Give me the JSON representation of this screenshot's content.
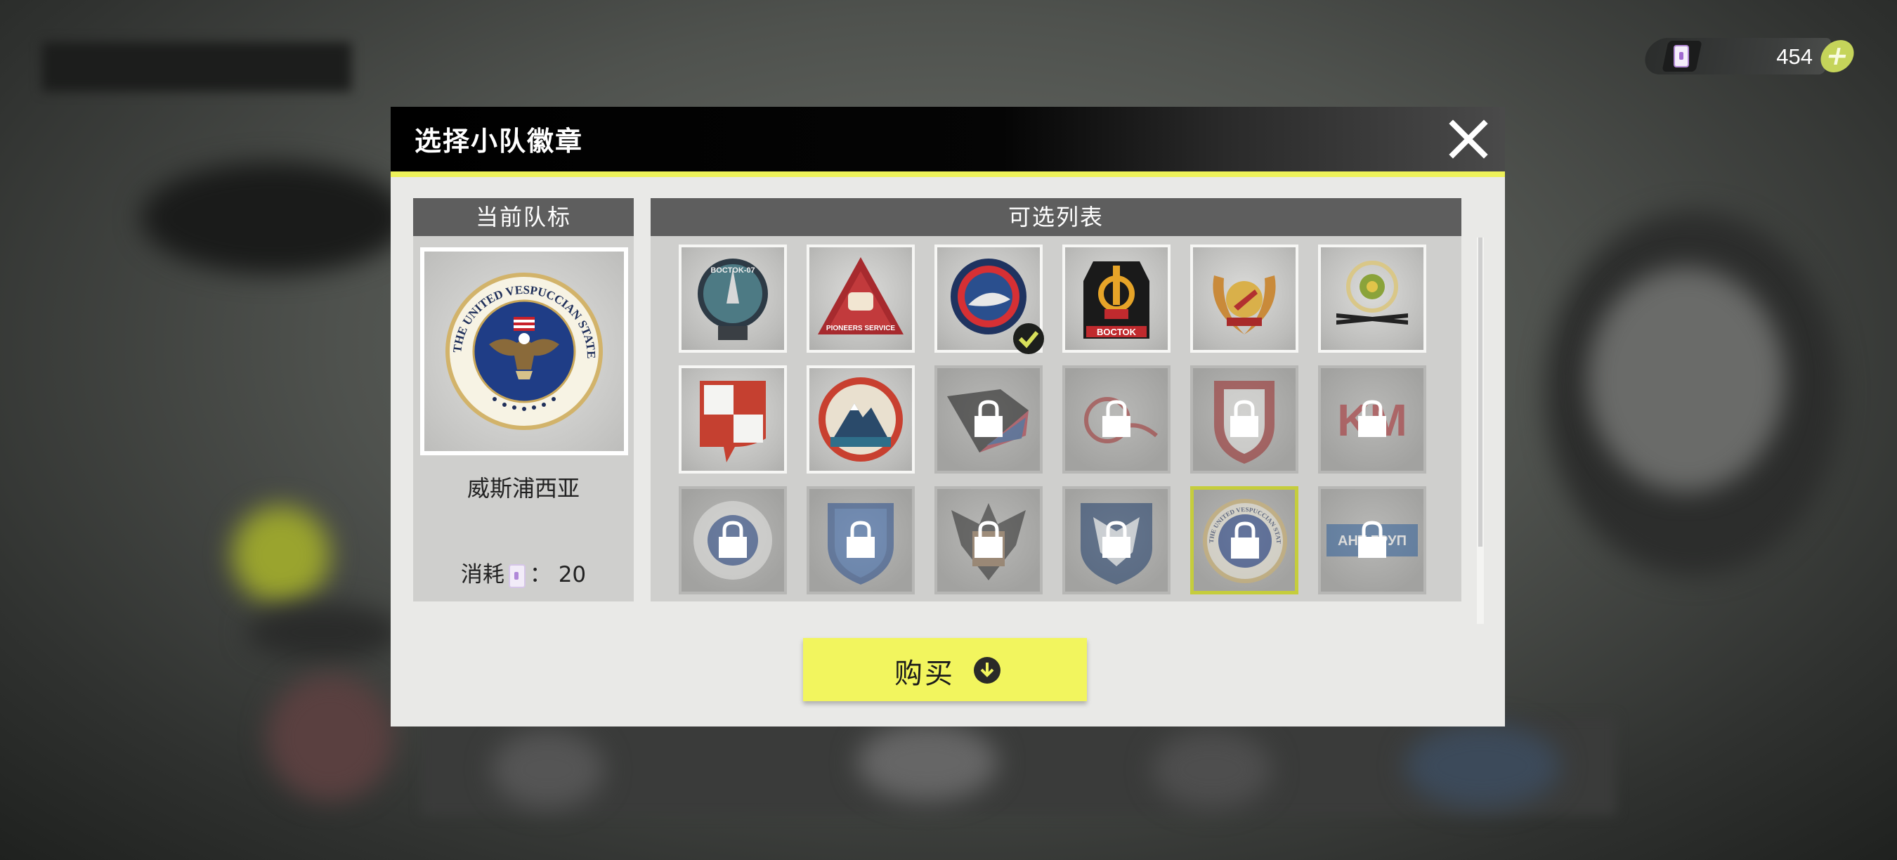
{
  "currency": {
    "amount": "454",
    "plus_label": "+"
  },
  "modal": {
    "title": "选择小队徽章",
    "current_header": "当前队标",
    "list_header": "可选列表",
    "current_name": "威斯浦西亚",
    "cost_label": "消耗",
    "cost_separator": "：",
    "cost_value": "20",
    "buy_label": "购买"
  },
  "current_badge": {
    "ring_text": "THE UNITED VESPUCCIAN STATES"
  },
  "badges": [
    {
      "text": "BOCTOK-07",
      "locked": false,
      "selected": false
    },
    {
      "text": "PIONEERS SERVICE",
      "locked": false,
      "selected": false
    },
    {
      "text": "",
      "locked": false,
      "selected": true
    },
    {
      "text": "BOCTOK",
      "locked": false,
      "selected": false
    },
    {
      "text": "",
      "locked": false,
      "selected": false
    },
    {
      "text": "",
      "locked": false,
      "selected": false
    },
    {
      "text": "",
      "locked": false,
      "selected": false
    },
    {
      "text": "",
      "locked": false,
      "selected": false
    },
    {
      "text": "",
      "locked": true,
      "selected": false
    },
    {
      "text": "",
      "locked": true,
      "selected": false
    },
    {
      "text": "",
      "locked": true,
      "selected": false
    },
    {
      "text": "KM",
      "locked": true,
      "selected": false
    },
    {
      "text": "",
      "locked": true,
      "selected": false
    },
    {
      "text": "",
      "locked": true,
      "selected": false
    },
    {
      "text": "",
      "locked": true,
      "selected": false
    },
    {
      "text": "",
      "locked": true,
      "selected": false
    },
    {
      "text": "THE UNITED VESPUCCIAN STATES",
      "locked": true,
      "selected": false,
      "highlighted": true
    },
    {
      "text": "АНТ ГРУП",
      "locked": true,
      "selected": false
    }
  ],
  "colors": {
    "accent": "#eef25a",
    "button": "#f2f55e",
    "header_bg": "#000000",
    "panel_head": "#5e5e5e",
    "highlight": "#c5cd3c"
  }
}
